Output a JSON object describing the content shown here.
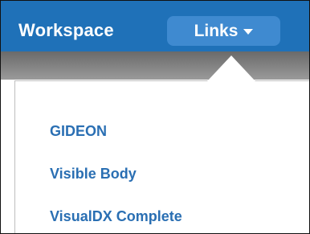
{
  "header": {
    "workspace_label": "Workspace",
    "links_label": "Links"
  },
  "menu": {
    "items": [
      {
        "label": "GIDEON"
      },
      {
        "label": "Visible Body"
      },
      {
        "label": "VisualDX Complete"
      }
    ]
  },
  "colors": {
    "topbar": "#1f71b8",
    "links_button": "#3f8ad0",
    "link_text": "#2a6fb3"
  }
}
